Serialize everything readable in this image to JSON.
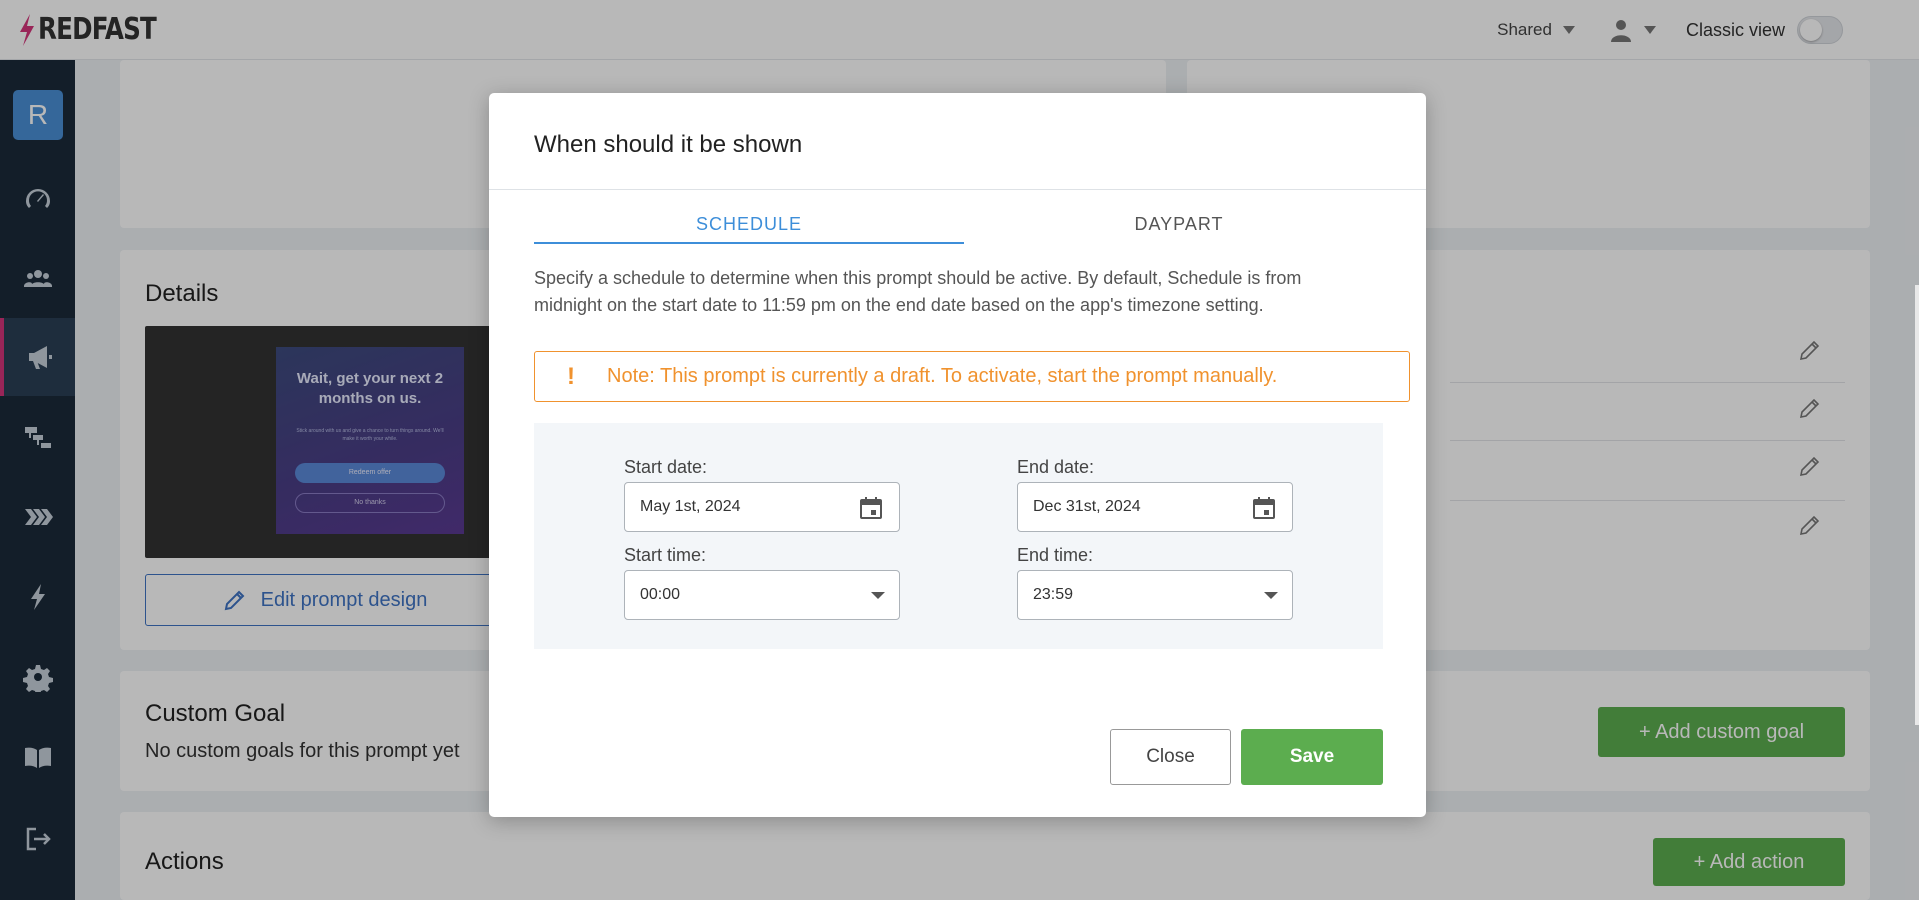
{
  "header": {
    "logo_text": "REDFAST",
    "shared_label": "Shared",
    "classic_view_label": "Classic view",
    "classic_view_on": false
  },
  "sidebar": {
    "avatar_letter": "R",
    "items": [
      {
        "icon": "dashboard-icon",
        "active": false
      },
      {
        "icon": "users-icon",
        "active": false
      },
      {
        "icon": "megaphone-icon",
        "active": true
      },
      {
        "icon": "flow-icon",
        "active": false
      },
      {
        "icon": "chevrons-icon",
        "active": false
      },
      {
        "icon": "bolt-icon",
        "active": false
      },
      {
        "icon": "gear-icon",
        "active": false
      },
      {
        "icon": "book-icon",
        "active": false
      },
      {
        "icon": "logout-icon",
        "active": false
      }
    ]
  },
  "main": {
    "details": {
      "title": "Details",
      "preview": {
        "headline": "Wait, get your next 2 months on us.",
        "body": "Stick around with us and give a chance to turn things around. We'll make it worth your while.",
        "primary_button": "Redeem offer",
        "secondary_button": "No thanks"
      },
      "edit_button": "Edit prompt design"
    },
    "custom_goal": {
      "title": "Custom Goal",
      "empty_text": "No custom goals for this prompt yet",
      "add_button": "+ Add custom goal"
    },
    "actions": {
      "title": "Actions",
      "add_button": "+ Add action"
    }
  },
  "modal": {
    "title": "When should it be shown",
    "tabs": [
      {
        "label": "SCHEDULE",
        "active": true
      },
      {
        "label": "DAYPART",
        "active": false
      }
    ],
    "description": "Specify a schedule to determine when this prompt should be active. By default, Schedule is from midnight on the start date to 11:59 pm on the end date based on the app's timezone setting.",
    "note_icon": "!",
    "note": "Note: This prompt is currently a draft. To activate, start the prompt manually.",
    "start_date_label": "Start date:",
    "start_date_value": "May 1st, 2024",
    "end_date_label": "End date:",
    "end_date_value": "Dec 31st, 2024",
    "start_time_label": "Start time:",
    "start_time_value": "00:00",
    "end_time_label": "End time:",
    "end_time_value": "23:59",
    "close_button": "Close",
    "save_button": "Save"
  },
  "colors": {
    "accent_blue": "#3d8ed9",
    "warning_orange": "#f0922e",
    "save_green": "#5cad4f",
    "sidebar_bg": "#1b2a3a",
    "active_marker": "#d4347a"
  }
}
